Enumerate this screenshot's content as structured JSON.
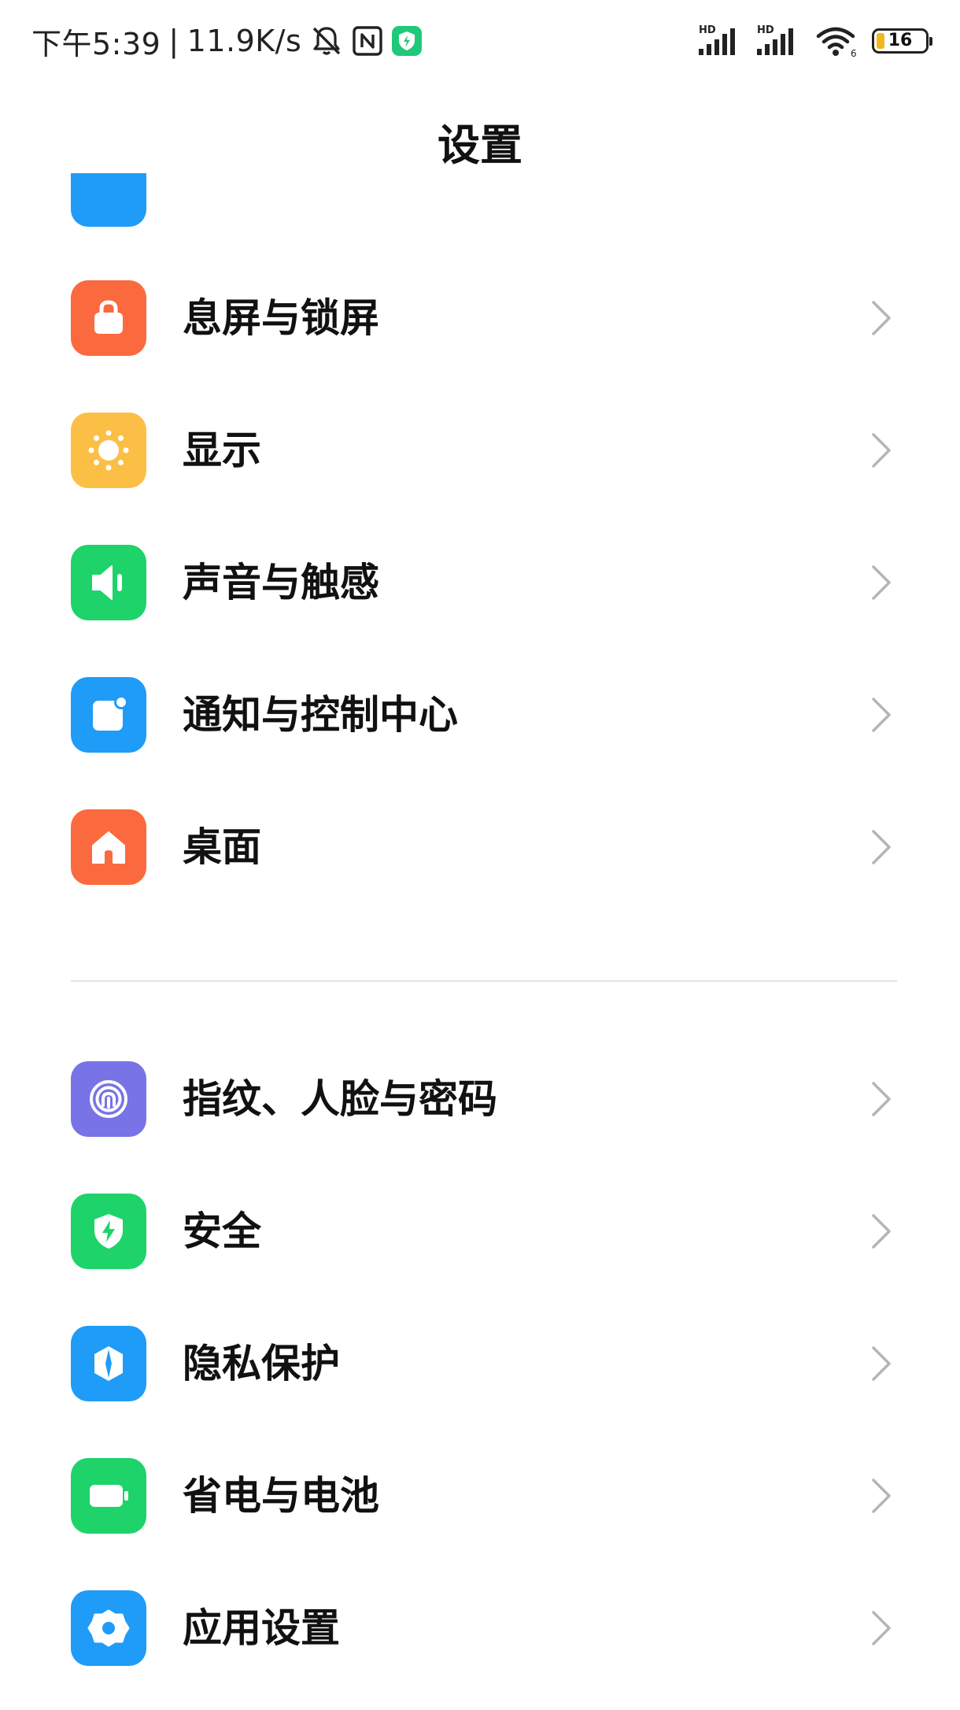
{
  "status_bar": {
    "time": "下午5:39",
    "separator": "|",
    "net_speed": "11.9K/s",
    "battery_level": "16",
    "battery_fraction": 0.16,
    "battery_color": "#f2b620",
    "icons": [
      "mute-icon",
      "nfc-icon",
      "shield-app-icon",
      "signal-hd-icon",
      "signal-hd-icon",
      "wifi-icon",
      "battery-icon"
    ]
  },
  "header": {
    "title": "设置"
  },
  "group1": [
    {
      "label": "息屏与锁屏",
      "icon": "lock-icon",
      "color": "#fa6a3e"
    },
    {
      "label": "显示",
      "icon": "sun-icon",
      "color": "#fcbf45"
    },
    {
      "label": "声音与触感",
      "icon": "speaker-icon",
      "color": "#1ed36a"
    },
    {
      "label": "通知与控制中心",
      "icon": "notification-icon",
      "color": "#1e9cf7"
    },
    {
      "label": "桌面",
      "icon": "home-icon",
      "color": "#fa6a3e"
    }
  ],
  "group2": [
    {
      "label": "指纹、人脸与密码",
      "icon": "fingerprint-icon",
      "color": "#7873e6"
    },
    {
      "label": "安全",
      "icon": "security-shield-icon",
      "color": "#1ed36a"
    },
    {
      "label": "隐私保护",
      "icon": "privacy-icon",
      "color": "#1e9cf7"
    },
    {
      "label": "省电与电池",
      "icon": "battery-saver-icon",
      "color": "#1ed36a"
    },
    {
      "label": "应用设置",
      "icon": "app-settings-gear-icon",
      "color": "#1e9cf7"
    }
  ]
}
